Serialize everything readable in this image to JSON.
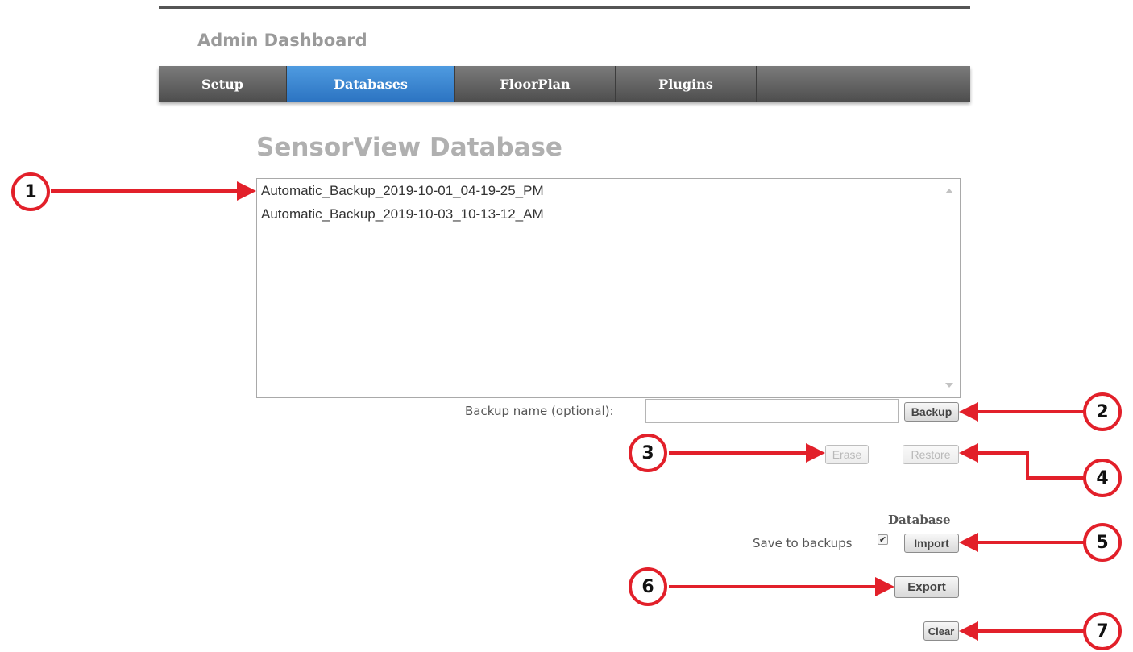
{
  "app_title": "Admin Dashboard",
  "nav": {
    "tabs": [
      {
        "label": "Setup",
        "active": false
      },
      {
        "label": "Databases",
        "active": true
      },
      {
        "label": "FloorPlan",
        "active": false
      },
      {
        "label": "Plugins",
        "active": false
      }
    ]
  },
  "page_title": "SensorView Database",
  "backups": {
    "items": [
      "Automatic_Backup_2019-10-01_04-19-25_PM",
      "Automatic_Backup_2019-10-03_10-13-12_AM"
    ]
  },
  "backup_form": {
    "label": "Backup name (optional):",
    "value": "",
    "backup_button": "Backup",
    "erase_button": "Erase",
    "restore_button": "Restore"
  },
  "database": {
    "heading": "Database",
    "save_to_backups_label": "Save to backups",
    "save_to_backups_checked": true,
    "import_button": "Import",
    "export_button": "Export",
    "clear_button": "Clear"
  },
  "callouts": [
    "1",
    "2",
    "3",
    "4",
    "5",
    "6",
    "7"
  ],
  "colors": {
    "callout_red": "#e2202a",
    "active_tab": "#3a86d4",
    "nav_bar": "#5e5e5e"
  }
}
